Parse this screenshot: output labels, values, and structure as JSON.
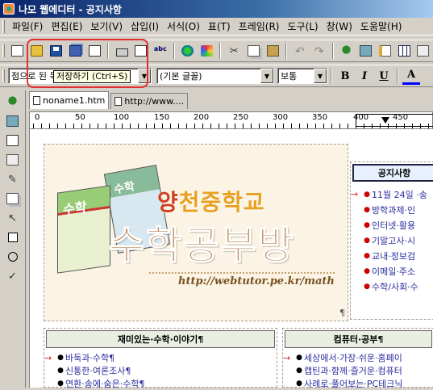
{
  "window": {
    "title": "나모 웹에디터 - 공지사항"
  },
  "menu": [
    "파일(F)",
    "편집(E)",
    "보기(V)",
    "삽입(I)",
    "서식(O)",
    "표(T)",
    "프레임(R)",
    "도구(L)",
    "창(W)",
    "도움말(H)"
  ],
  "toolbar": {
    "icons": [
      "new-icon",
      "open-icon",
      "save-icon",
      "save-all-icon",
      "mail-icon",
      "print-icon",
      "preview-icon",
      "spell-check-icon",
      "globe-icon",
      "color-icon",
      "cut-icon",
      "copy-icon",
      "paste-icon",
      "undo-icon",
      "redo-icon",
      "tree-icon",
      "image-icon",
      "edit-icon",
      "table-icon",
      "list-icon"
    ],
    "tooltip": "저장하기 (Ctrl+S)"
  },
  "format": {
    "paragraph_value": "점으로 된 목록",
    "font_value": "(기본 글꼴)",
    "size_value": "보통",
    "bold": "B",
    "italic": "I",
    "underline": "U",
    "color": "A"
  },
  "tabs": [
    {
      "label": "noname1.htm"
    },
    {
      "label": "http://www...."
    }
  ],
  "ruler": {
    "labels": [
      "0",
      "50",
      "100",
      "150",
      "200",
      "250",
      "300",
      "350",
      "400",
      "450"
    ]
  },
  "banner": {
    "school_first": "양",
    "school_rest": "천중학교",
    "title": "수학공부방",
    "url": "http://webtutor.pe.kr/math",
    "book_title": "수학",
    "book2_title": "수학"
  },
  "notice": {
    "header": "공지사항",
    "items": [
      {
        "text": "11월 24일 ·송",
        "arrow": true
      },
      {
        "text": "방학과제·인",
        "arrow": false
      },
      {
        "text": "인터넷·활용",
        "arrow": false
      },
      {
        "text": "기말고사·시",
        "arrow": false
      },
      {
        "text": "교내·정보검",
        "arrow": false
      },
      {
        "text": "이메일·주소",
        "arrow": false
      },
      {
        "text": "수학/사회·수",
        "arrow": false
      }
    ]
  },
  "left_section": {
    "header": "재미있는·수학·이야기¶",
    "items": [
      {
        "text": "바둑과·수학¶",
        "arrow": true
      },
      {
        "text": "신통한·여론조사¶",
        "arrow": false
      },
      {
        "text": "연환·송에·숨은·수학¶",
        "arrow": false
      }
    ]
  },
  "right_section": {
    "header": "컴퓨터·공부¶",
    "items": [
      {
        "text": "세상에서·가장·쉬운·홈페이",
        "arrow": true
      },
      {
        "text": "캡틴과·함께·즐거운·컴퓨터",
        "arrow": false
      },
      {
        "text": "사례로·풀어보는·PC테크닉",
        "arrow": false
      }
    ]
  },
  "colors": {
    "title_bar": "#0a246a",
    "highlight_box": "#e03030",
    "link": "#2a2aa0",
    "arrow": "#e02020"
  }
}
